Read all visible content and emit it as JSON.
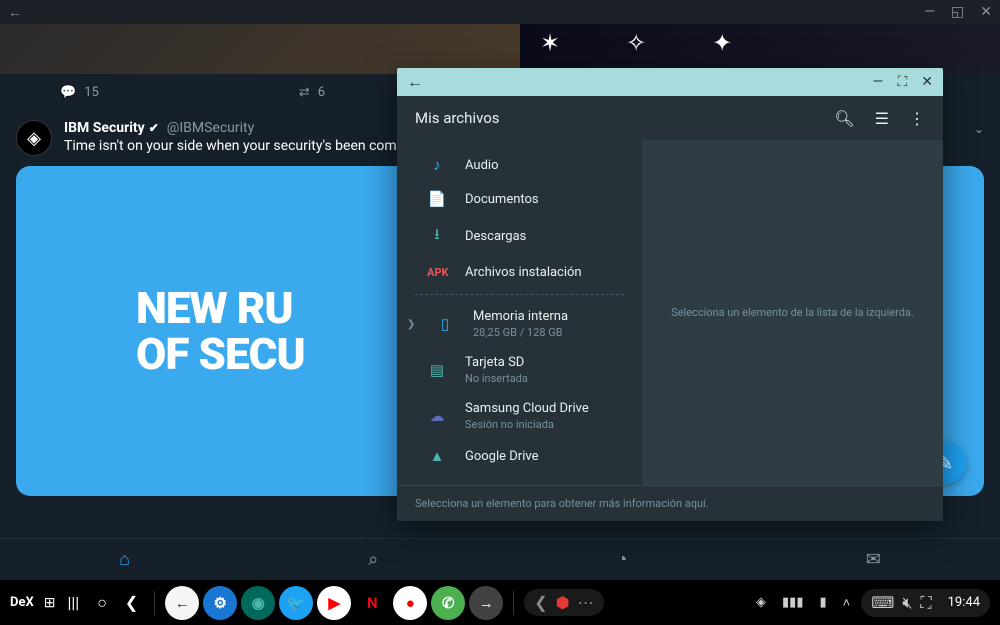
{
  "window_chrome": {
    "back": "←",
    "minimize": "—",
    "maximize": "◱",
    "close": "✕"
  },
  "twitter": {
    "reply_count": "15",
    "retweet_count": "6",
    "account_name": "IBM Security",
    "account_handle": "@IBMSecurity",
    "tweet_text": "Time isn't on your side when your security's been compromi",
    "card_line1": "NEW RU",
    "card_line2": "OF SECU",
    "nav": {
      "home": "⌂",
      "search": "⌕",
      "notifications": "◔",
      "messages": "✉"
    }
  },
  "file_manager": {
    "titlebar": {
      "back": "←",
      "minimize": "—",
      "maximize": "⛶",
      "close": "✕"
    },
    "title": "Mis archivos",
    "items": [
      {
        "icon": "♪",
        "label": "Audio",
        "cls": "audio"
      },
      {
        "icon": "📄",
        "label": "Documentos",
        "cls": "doc"
      },
      {
        "icon": "⭳",
        "label": "Descargas",
        "cls": "download"
      },
      {
        "icon": "APK",
        "label": "Archivos instalación",
        "cls": "apk"
      }
    ],
    "storage": [
      {
        "icon": "▯",
        "label": "Memoria interna",
        "sub": "28,25 GB / 128 GB",
        "cls": "storage",
        "chevron": true
      },
      {
        "icon": "▤",
        "label": "Tarjeta SD",
        "sub": "No insertada",
        "cls": "sd"
      },
      {
        "icon": "☁",
        "label": "Samsung Cloud Drive",
        "sub": "Sesión no iniciada",
        "cls": "cloud"
      },
      {
        "icon": "▲",
        "label": "Google Drive",
        "sub": "",
        "cls": "gdrive"
      }
    ],
    "content_placeholder": "Selecciona un elemento de la lista de la izquierda.",
    "footer_text": "Selecciona un elemento para obtener más información aquí."
  },
  "taskbar": {
    "dex_label": "DeX",
    "apps": [
      {
        "bg": "#f5f5f5",
        "txt": "←",
        "fg": "#333"
      },
      {
        "bg": "#1976d2",
        "txt": "⚙",
        "fg": "#fff"
      },
      {
        "bg": "#00695c",
        "txt": "◉",
        "fg": "#4db6ac"
      },
      {
        "bg": "#1da1f2",
        "txt": "🐦",
        "fg": "#fff"
      },
      {
        "bg": "#fff",
        "txt": "▶",
        "fg": "#f00"
      },
      {
        "bg": "#000",
        "txt": "N",
        "fg": "#e50914"
      },
      {
        "bg": "#fff",
        "txt": "●",
        "fg": "#f00"
      },
      {
        "bg": "#4caf50",
        "txt": "✆",
        "fg": "#fff"
      },
      {
        "bg": "#424242",
        "txt": "→",
        "fg": "#fff"
      }
    ],
    "time": "19:44"
  }
}
